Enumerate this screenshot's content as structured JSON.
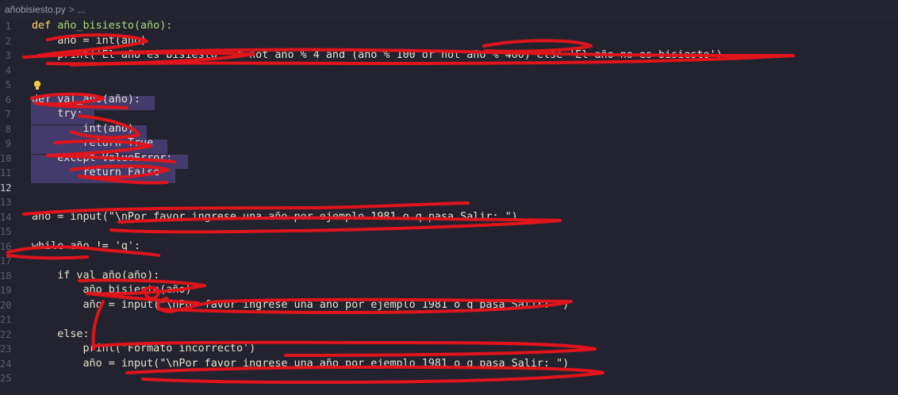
{
  "breadcrumb": {
    "file": "añobisiesto.py",
    "separator": ">",
    "more": "..."
  },
  "line_numbers": [
    "1",
    "2",
    "3",
    "4",
    "5",
    "6",
    "7",
    "8",
    "9",
    "10",
    "11",
    "12",
    "13",
    "14",
    "15",
    "16",
    "17",
    "18",
    "19",
    "20",
    "21",
    "22",
    "23",
    "24",
    "25"
  ],
  "active_line": "12",
  "code": {
    "l1_def": "def",
    "l1_rest": " año_bisiesto(año):",
    "l2": "    año = int(año)",
    "l3": "    print('El año es bisiesto' if not año % 4 and (año % 100 or not año % 400) else 'El año no es bisiesto')",
    "l6": "def val_año(año):",
    "l7": "    try:",
    "l8": "        int(año)",
    "l9": "        return True",
    "l10": "    except ValueError:",
    "l11": "        return False",
    "l14": "año = input(\"\\nPor favor ingrese una año por ejemplo 1981 o q pasa Salir: \")",
    "l16": "while año != 'q':",
    "l18": "    if val_año(año):",
    "l19": "        año_bisiesto(año)",
    "l20": "        año = input(\"\\nPor favor ingrese una año por ejemplo 1981 o q pasa Salir: \")",
    "l22": "    else:",
    "l23": "        print('Formato incorrecto')",
    "l24": "        año = input(\"\\nPor favor ingrese una año por ejemplo 1981 o q pasa Salir: \")"
  },
  "colors": {
    "background": "#23232f",
    "selection": "#4a3f78",
    "scribble": "#e0141b"
  }
}
